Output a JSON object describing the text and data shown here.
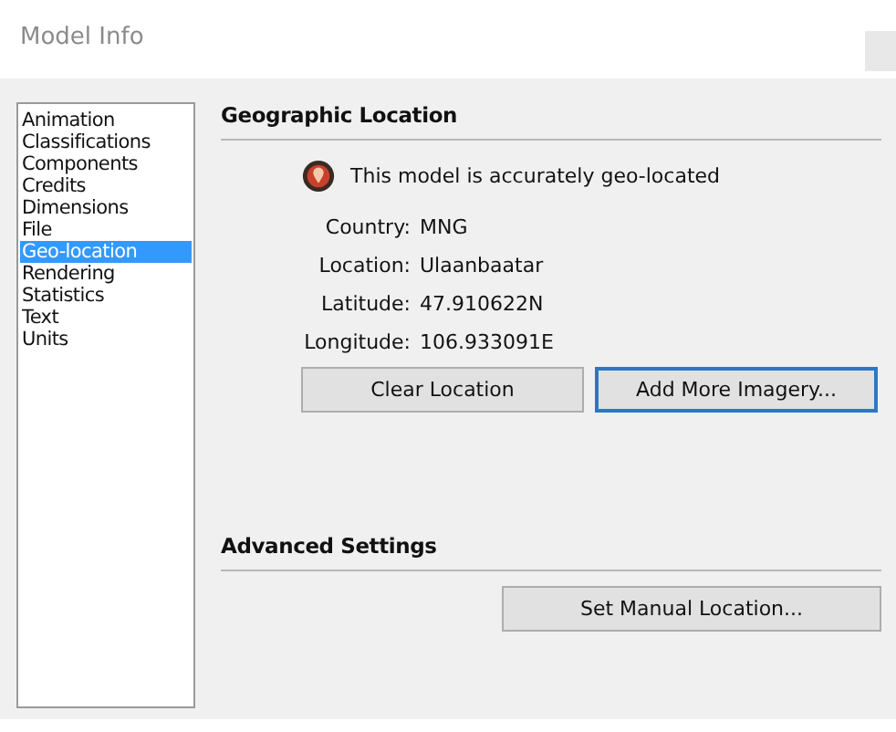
{
  "window": {
    "title": "Model Info"
  },
  "sidebar": {
    "items": [
      {
        "label": "Animation",
        "selected": false
      },
      {
        "label": "Classifications",
        "selected": false
      },
      {
        "label": "Components",
        "selected": false
      },
      {
        "label": "Credits",
        "selected": false
      },
      {
        "label": "Dimensions",
        "selected": false
      },
      {
        "label": "File",
        "selected": false
      },
      {
        "label": "Geo-location",
        "selected": true
      },
      {
        "label": "Rendering",
        "selected": false
      },
      {
        "label": "Statistics",
        "selected": false
      },
      {
        "label": "Text",
        "selected": false
      },
      {
        "label": "Units",
        "selected": false
      }
    ]
  },
  "geographic_location": {
    "heading": "Geographic Location",
    "status": "This model is accurately geo-located",
    "fields": [
      {
        "label": "Country:",
        "value": "MNG"
      },
      {
        "label": "Location:",
        "value": "Ulaanbaatar"
      },
      {
        "label": "Latitude:",
        "value": "47.910622N"
      },
      {
        "label": "Longitude:",
        "value": "106.933091E"
      }
    ],
    "buttons": [
      {
        "label": "Clear Location",
        "focused": false
      },
      {
        "label": "Add More Imagery...",
        "focused": true
      }
    ]
  },
  "advanced_settings": {
    "heading": "Advanced Settings",
    "buttons": [
      {
        "label": "Set Manual Location...",
        "focused": false
      }
    ]
  }
}
